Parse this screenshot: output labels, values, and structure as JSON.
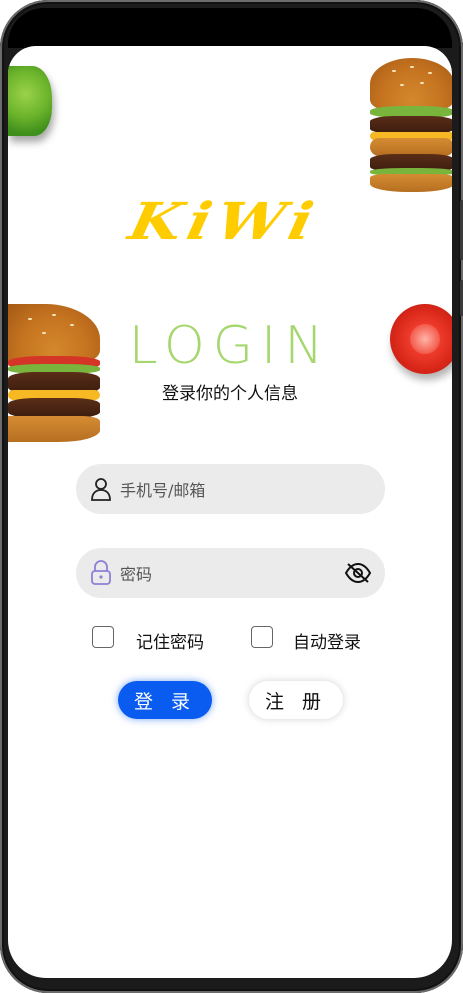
{
  "app": {
    "brand": "KiWi",
    "title": "LOGIN",
    "subtitle": "登录你的个人信息"
  },
  "form": {
    "account_placeholder": "手机号/邮箱",
    "password_placeholder": "密码",
    "remember_label": "记住密码",
    "auto_login_label": "自动登录",
    "login_button": "登 录",
    "register_button": "注 册"
  },
  "colors": {
    "brand": "#ffcc00",
    "title": "#a5d76e",
    "primary_button": "#0a5cf0",
    "field_background": "#ebebeb"
  },
  "icons": {
    "account": "user-icon",
    "password": "lock-icon",
    "toggle_visibility": "eye-off-icon"
  }
}
